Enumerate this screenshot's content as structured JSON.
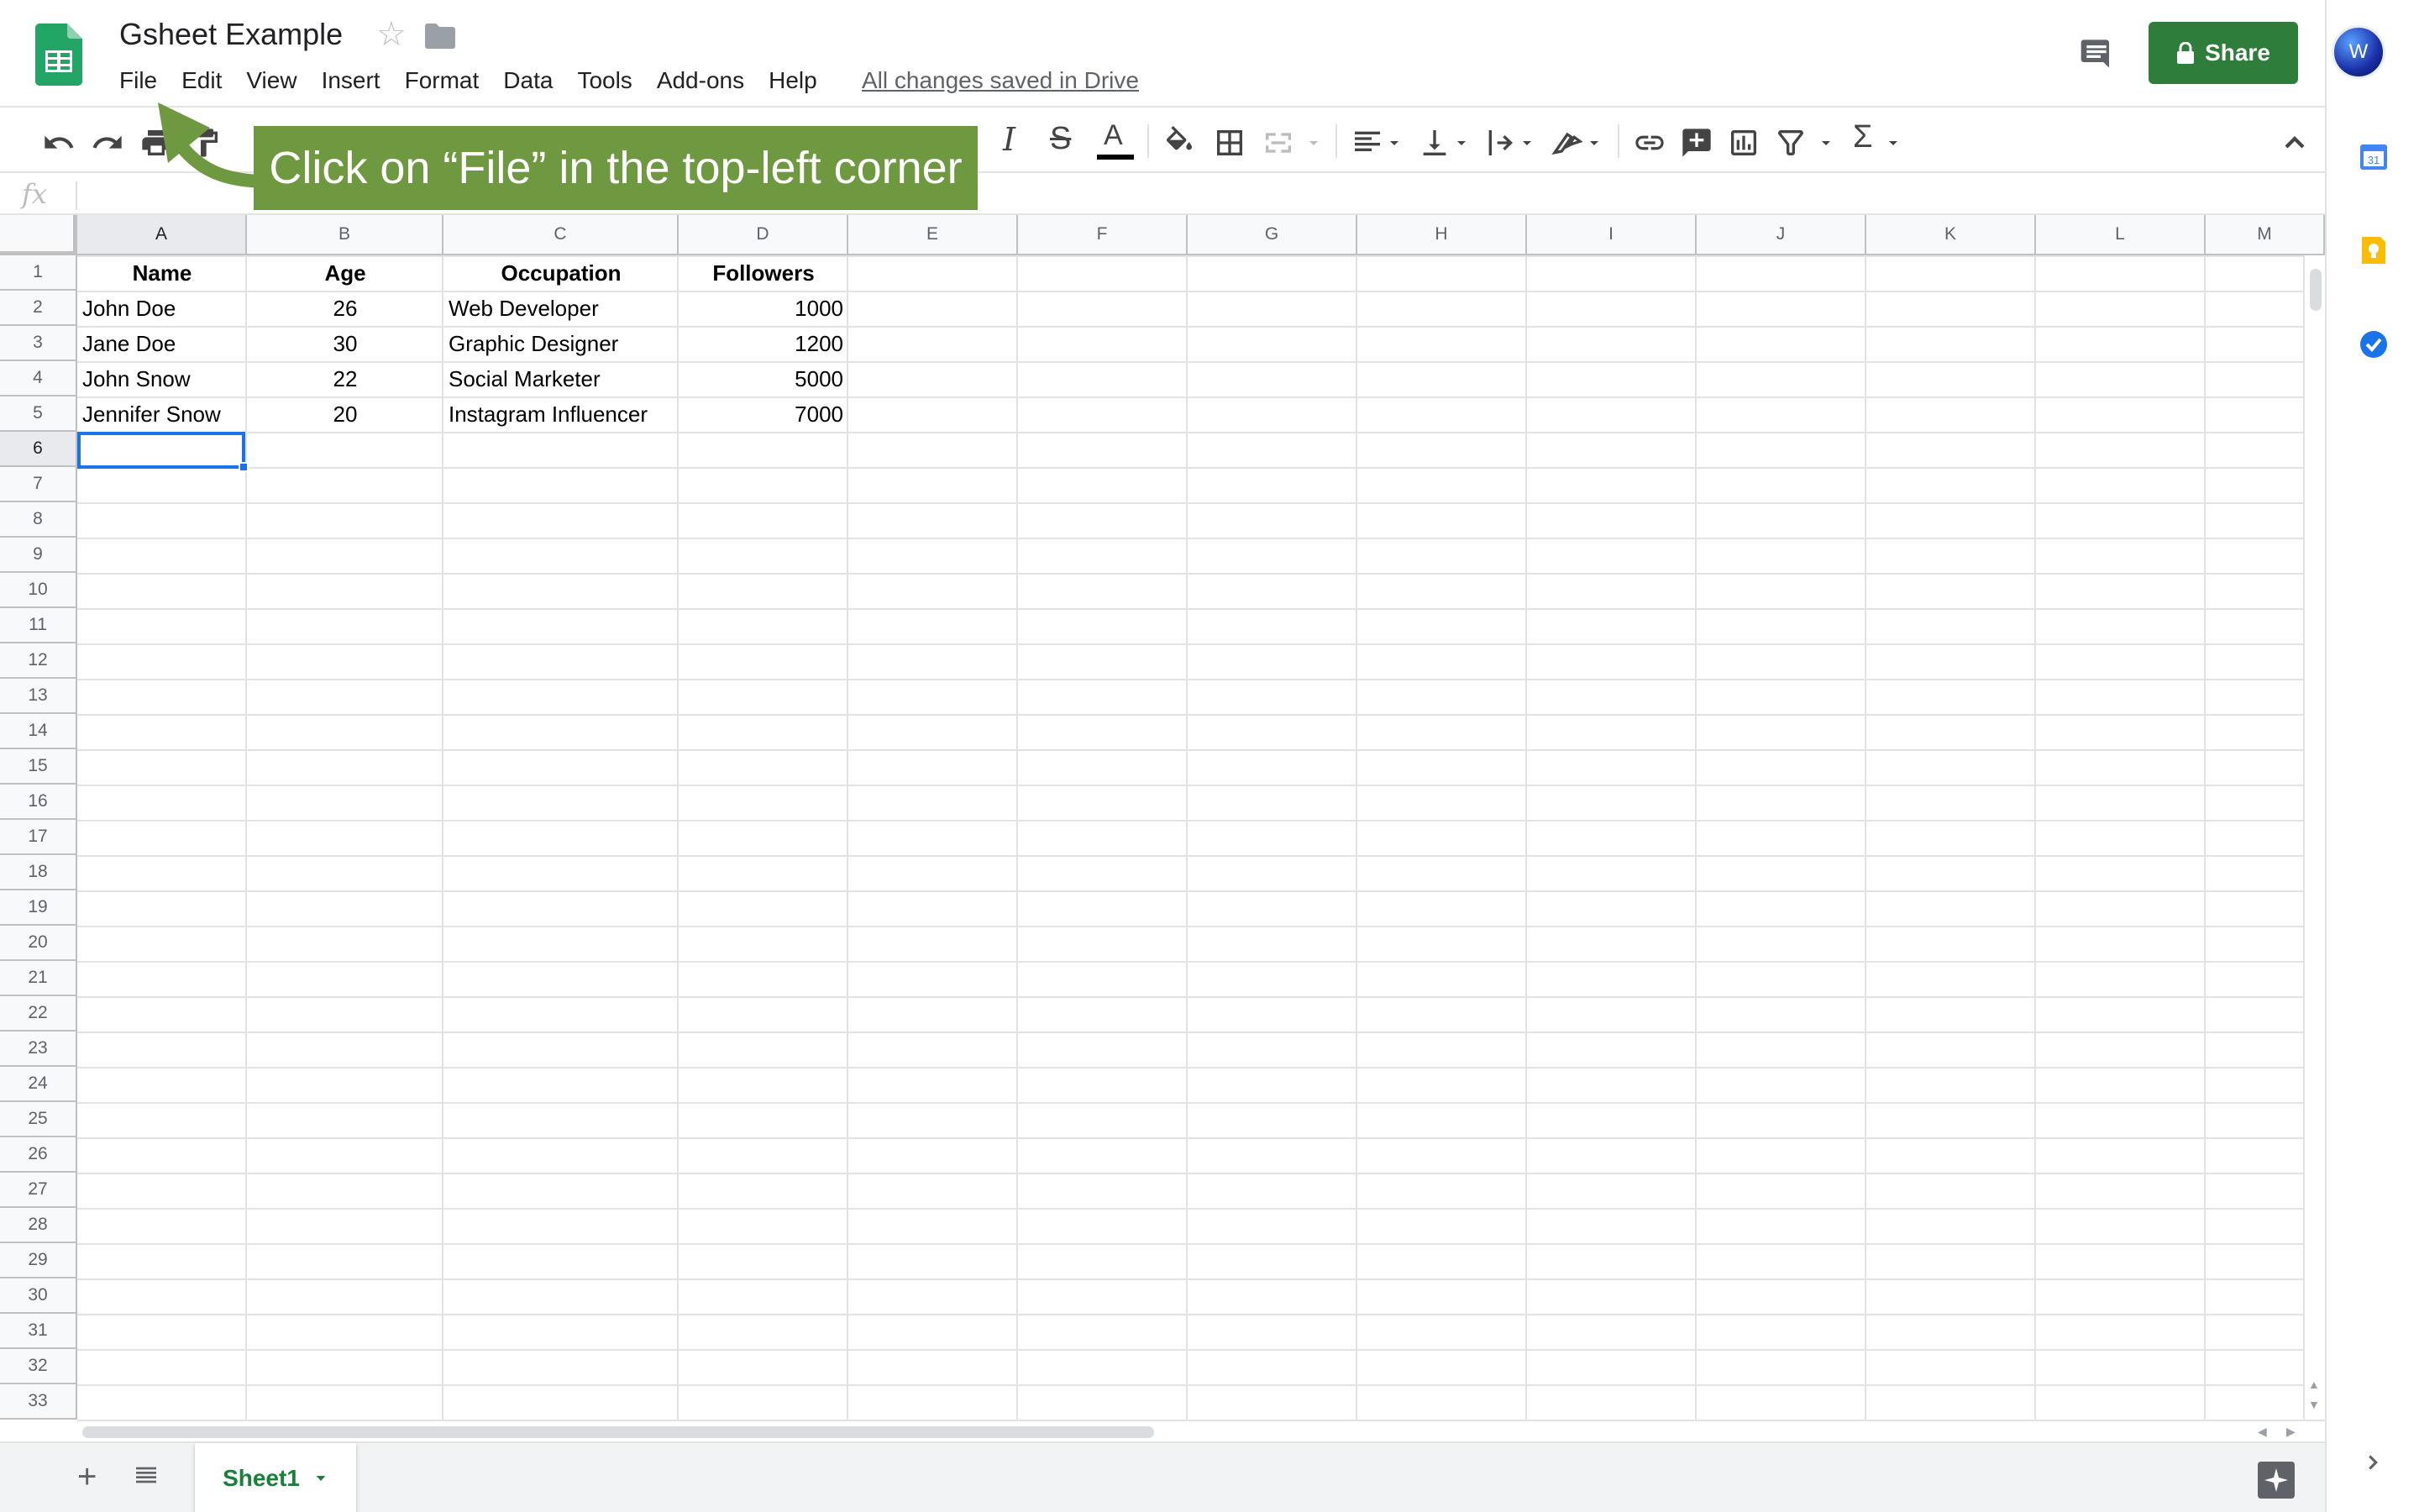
{
  "header": {
    "doc_title": "Gsheet Example",
    "saved_status": "All changes saved in Drive",
    "share_label": "Share",
    "avatar_initial": "W",
    "menu": [
      "File",
      "Edit",
      "View",
      "Insert",
      "Format",
      "Data",
      "Tools",
      "Add-ons",
      "Help"
    ]
  },
  "side_panel": {
    "calendar_day": "31"
  },
  "formula_bar": {
    "fx_label": "fx",
    "value": ""
  },
  "columns": [
    "A",
    "B",
    "C",
    "D",
    "E",
    "F",
    "G",
    "H",
    "I",
    "J",
    "K",
    "L",
    "M"
  ],
  "rows": [
    "1",
    "2",
    "3",
    "4",
    "5",
    "6",
    "7",
    "8",
    "9",
    "10",
    "11",
    "12",
    "13",
    "14",
    "15",
    "16",
    "17",
    "18",
    "19",
    "20",
    "21",
    "22",
    "23",
    "24",
    "25",
    "26",
    "27",
    "28",
    "29",
    "30",
    "31",
    "32",
    "33"
  ],
  "table": {
    "headers": [
      "Name",
      "Age",
      "Occupation",
      "Followers"
    ],
    "rows": [
      [
        "John Doe",
        "26",
        "Web Developer",
        "1000"
      ],
      [
        "Jane Doe",
        "30",
        "Graphic Designer",
        "1200"
      ],
      [
        "John Snow",
        "22",
        "Social Marketer",
        "5000"
      ],
      [
        "Jennifer Snow",
        "20",
        "Instagram Influencer",
        "7000"
      ]
    ]
  },
  "selected_cell": "A6",
  "sheets": {
    "active": "Sheet1"
  },
  "callout": {
    "text": "Click on “File” in the top-left corner",
    "color": "#6f9941"
  },
  "colors": {
    "brand_green": "#2f7d3a",
    "selection_blue": "#1a73e8",
    "sheet_tab_green": "#188038"
  }
}
